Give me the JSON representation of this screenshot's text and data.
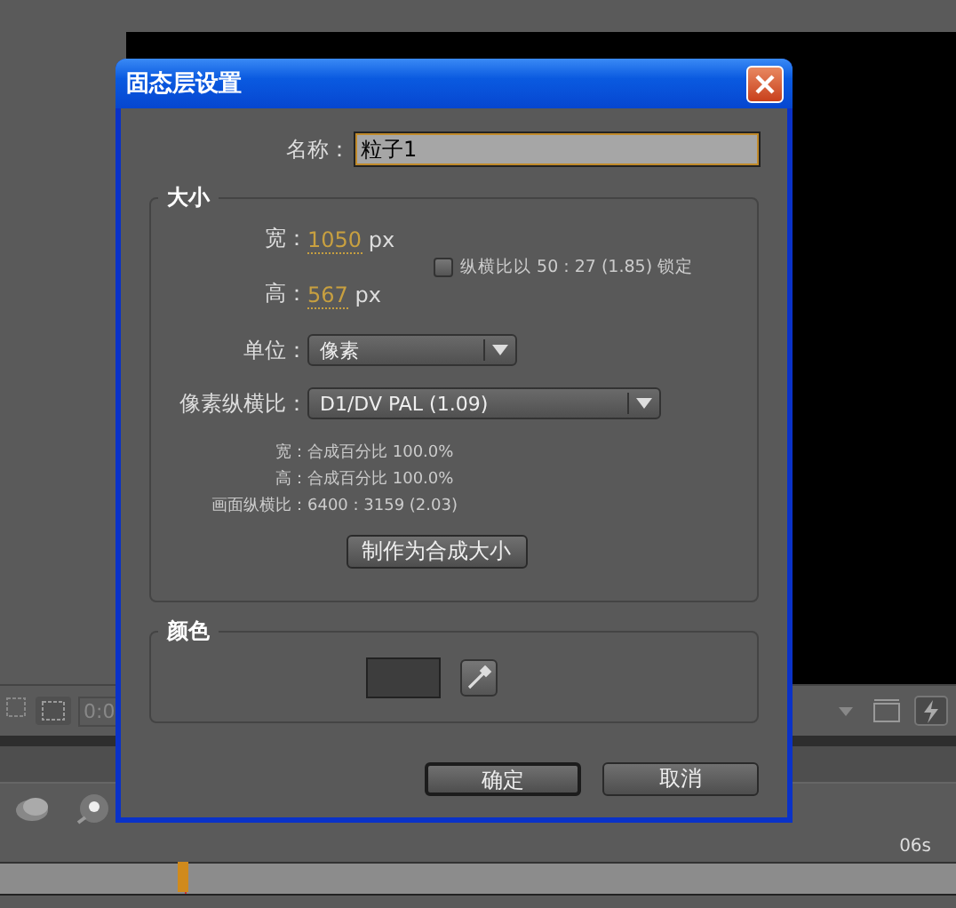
{
  "app": {
    "timecode": "0:0",
    "ruler_labels": [
      "06s"
    ]
  },
  "dialog": {
    "title": "固态层设置",
    "name": {
      "label": "名称：",
      "value": "粒子1"
    },
    "size": {
      "title": "大小",
      "width": {
        "label": "宽：",
        "value": "1050",
        "unit": "px"
      },
      "height": {
        "label": "高：",
        "value": "567",
        "unit": "px"
      },
      "lock": {
        "label": "纵横比以 50 : 27 (1.85) 锁定",
        "checked": false
      },
      "units": {
        "label": "单位：",
        "value": "像素"
      },
      "pixel_aspect": {
        "label": "像素纵横比：",
        "value": "D1/DV PAL (1.09)"
      },
      "info": [
        {
          "label": "宽：",
          "value": "合成百分比 100.0%"
        },
        {
          "label": "高：",
          "value": "合成百分比 100.0%"
        },
        {
          "label": "画面纵横比：",
          "value": "6400 : 3159 (2.03)"
        }
      ],
      "make_comp_size": "制作为合成大小"
    },
    "color": {
      "title": "颜色",
      "color": "#3d3d3d"
    },
    "buttons": [
      {
        "label": "确定",
        "default": true
      },
      {
        "label": "取消",
        "default": false
      }
    ]
  }
}
